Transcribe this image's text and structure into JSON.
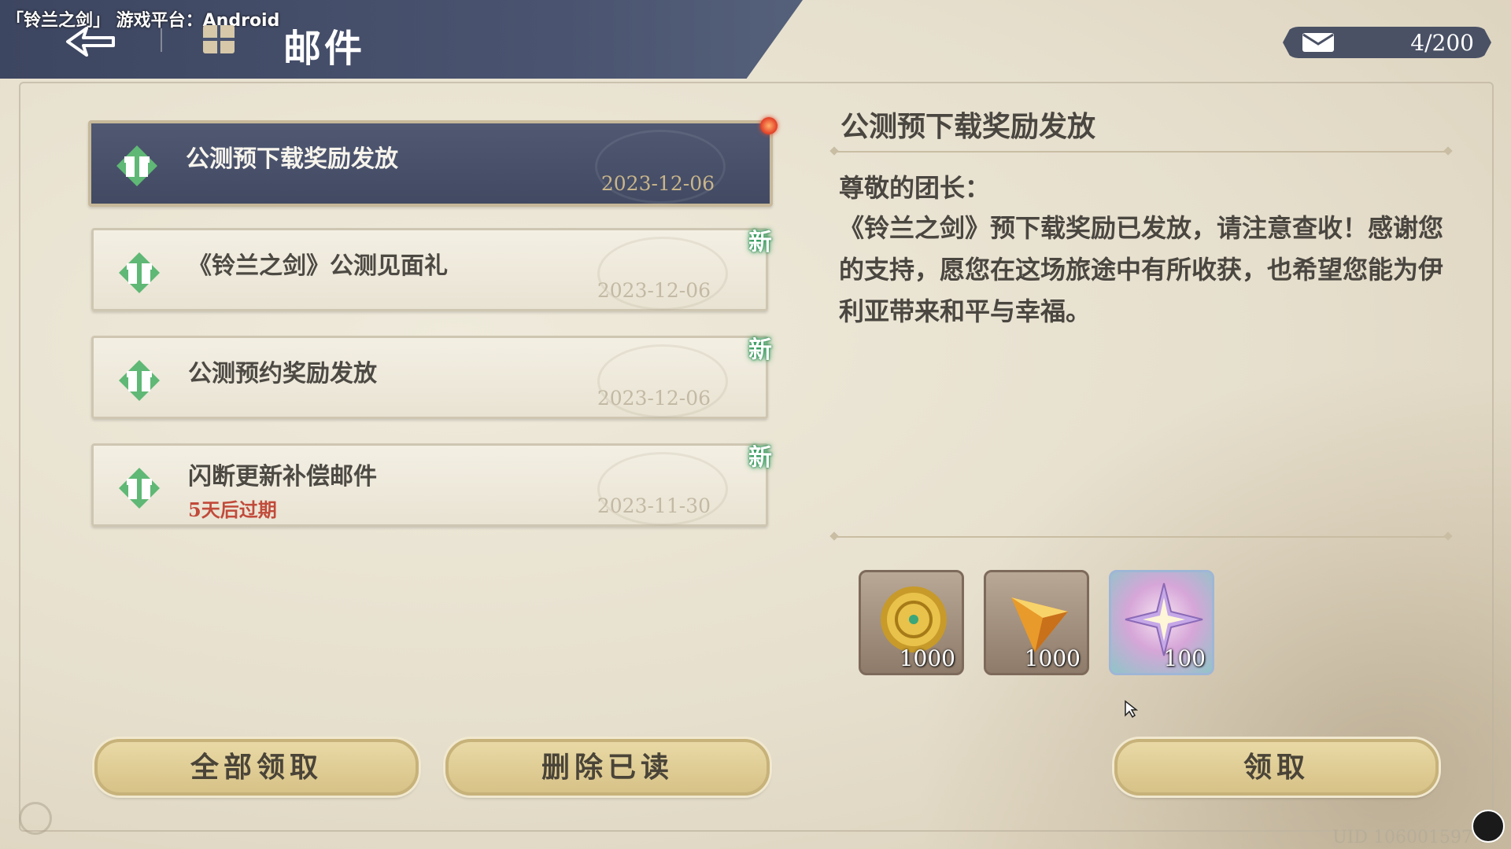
{
  "platform_label": "「铃兰之剑」 游戏平台：Android",
  "header": {
    "title": "邮件"
  },
  "mailbox": {
    "count": "4/200"
  },
  "mail_list": [
    {
      "title": "公测预下载奖励发放",
      "date": "2023-12-06",
      "selected": true,
      "badge": ""
    },
    {
      "title": "《铃兰之剑》公测见面礼",
      "date": "2023-12-06",
      "selected": false,
      "badge": "新"
    },
    {
      "title": "公测预约奖励发放",
      "date": "2023-12-06",
      "selected": false,
      "badge": "新"
    },
    {
      "title": "闪断更新补偿邮件",
      "date": "2023-11-30",
      "selected": false,
      "badge": "新",
      "expiry": "5天后过期"
    }
  ],
  "detail": {
    "title": "公测预下载奖励发放",
    "greeting": "尊敬的团长：",
    "body": "《铃兰之剑》预下载奖励已发放，请注意查收！感谢您的支持，愿您在这场旅途中有所收获，也希望您能为伊利亚带来和平与幸福。",
    "rewards": [
      {
        "icon": "gold-coin-icon",
        "qty": "1000"
      },
      {
        "icon": "amber-crystal-icon",
        "qty": "1000"
      },
      {
        "icon": "star-crystal-icon",
        "qty": "100"
      }
    ]
  },
  "buttons": {
    "claim_all": "全部领取",
    "delete_read": "删除已读",
    "claim": "领取"
  },
  "uid": "UID 106001597 8",
  "colors": {
    "header_bg": "#3d4660",
    "selected_item": "#424a63",
    "button": "#d7c287",
    "new_badge_glow": "#2e9a5a",
    "expiry": "#c14a3a"
  }
}
